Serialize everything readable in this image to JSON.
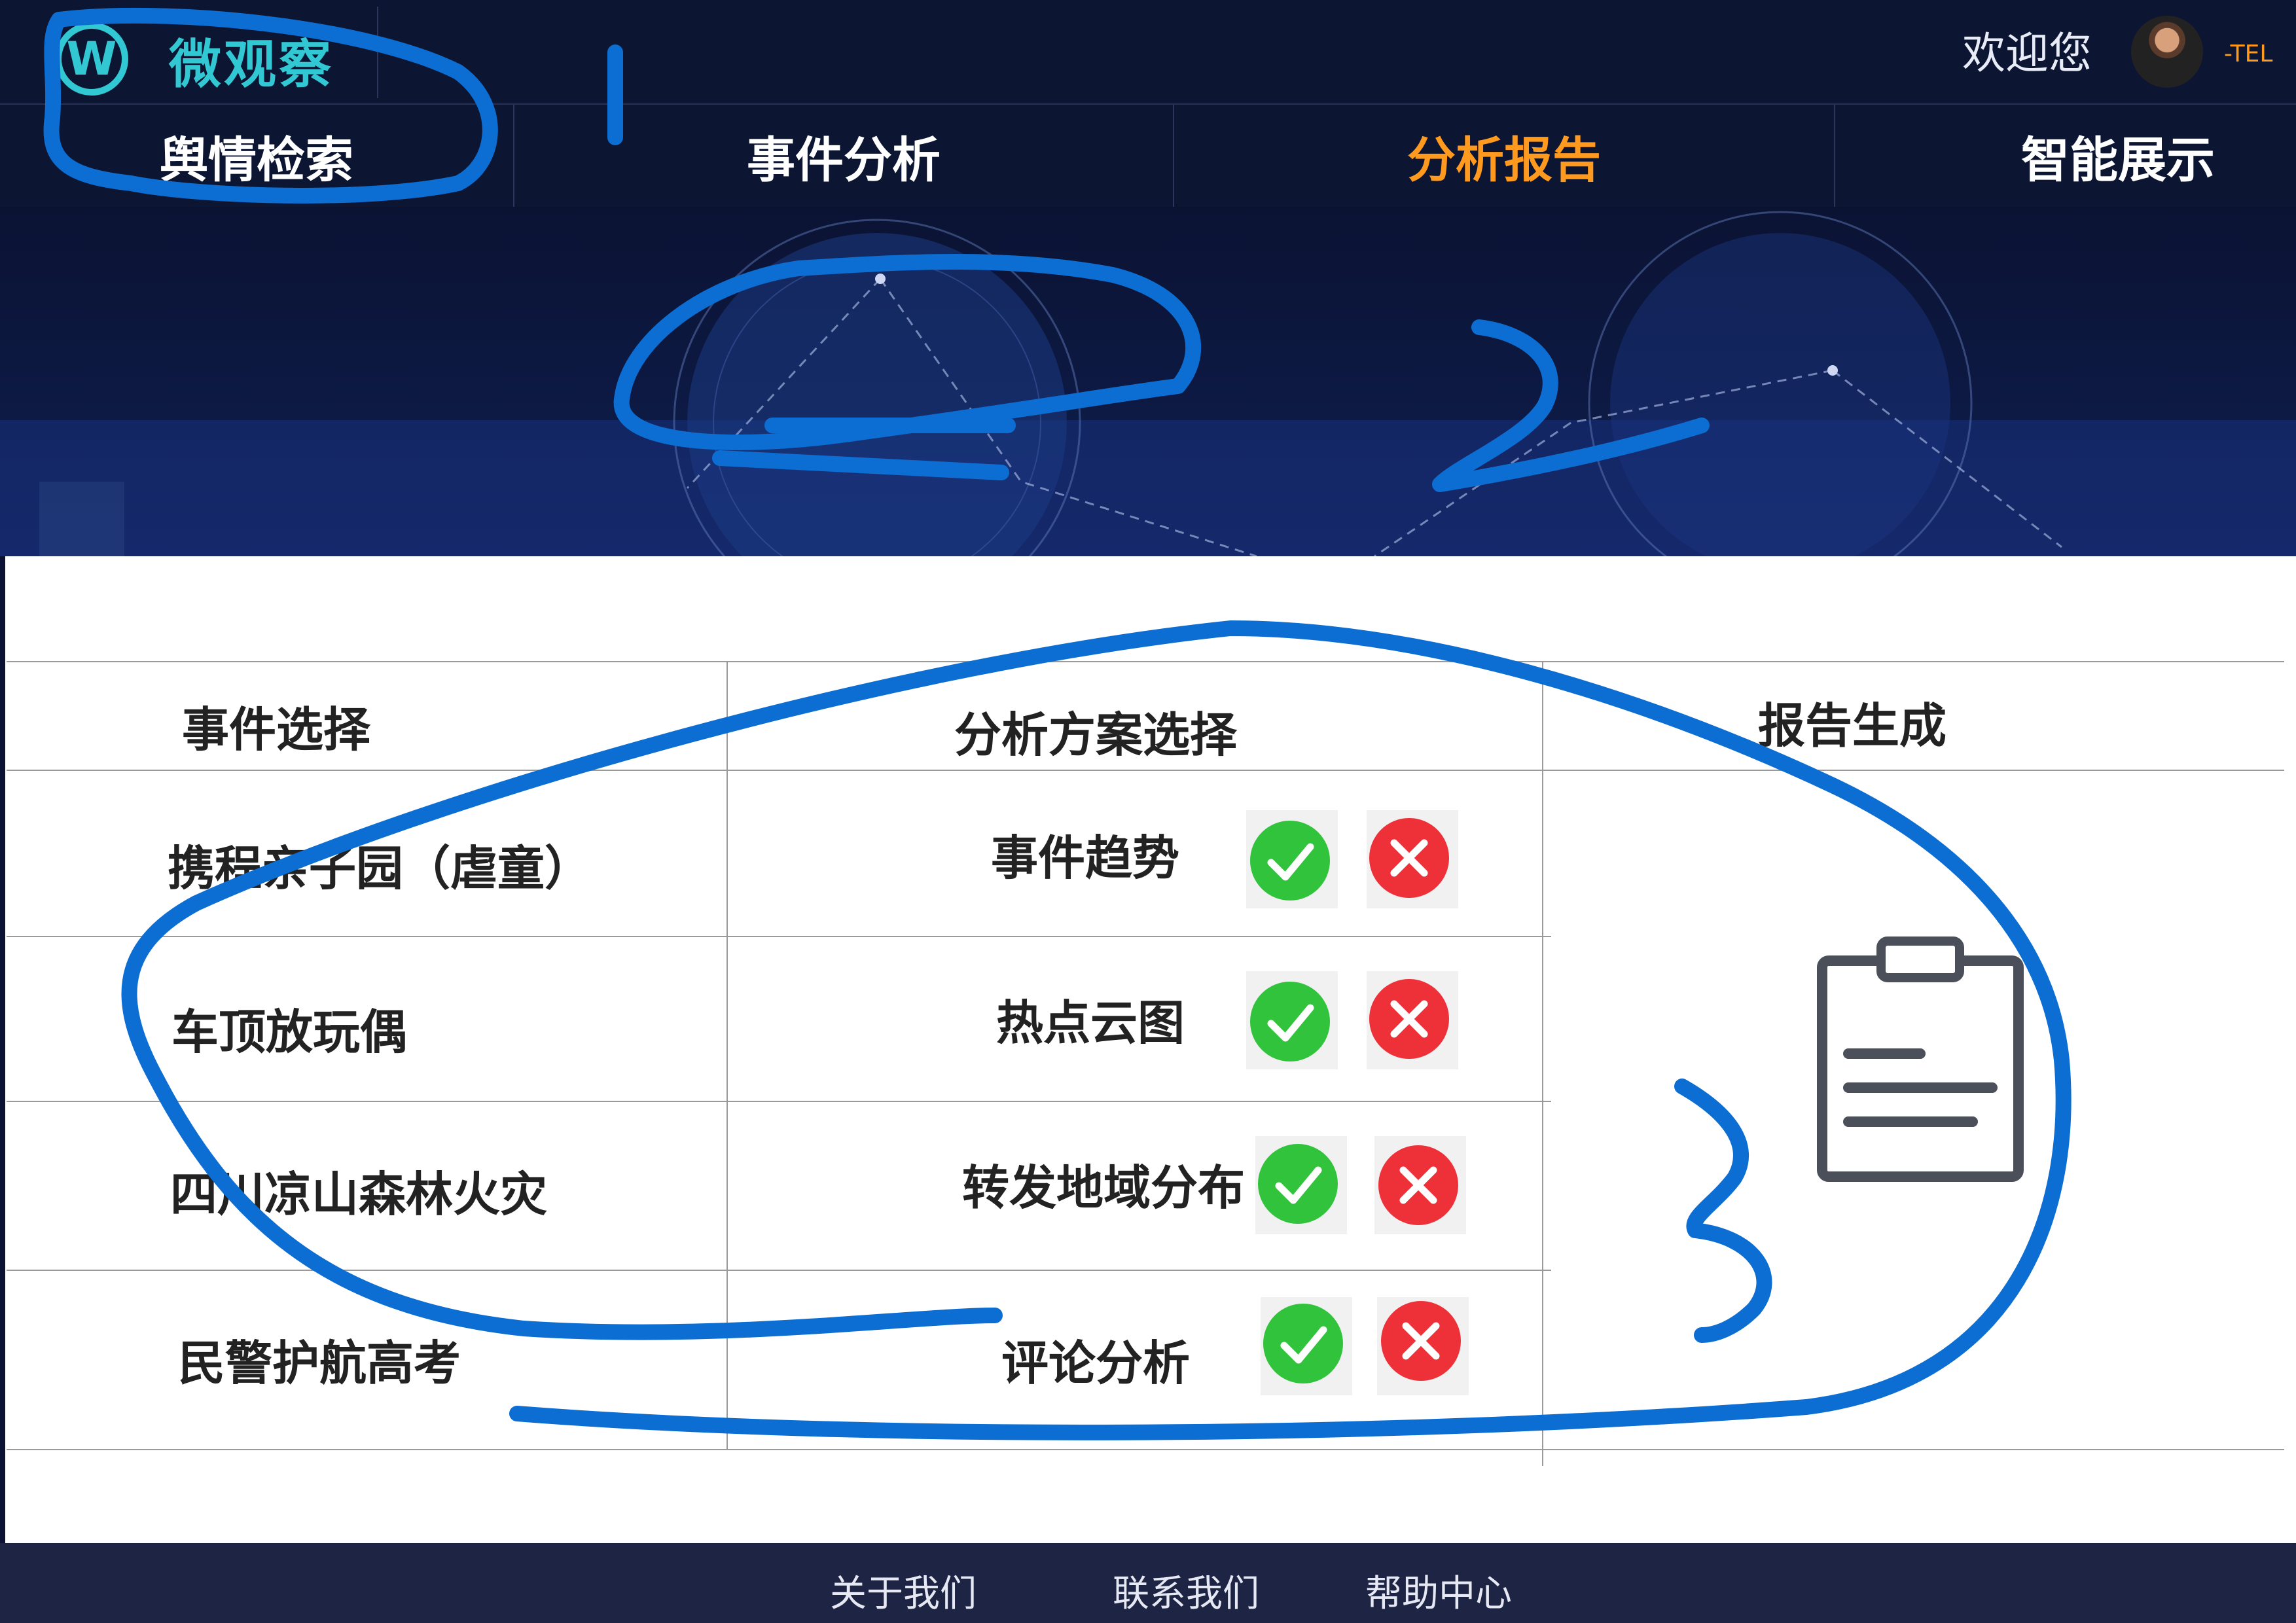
{
  "header": {
    "logo_letter": "W",
    "logo_text": "微观察",
    "welcome": "欢迎您",
    "username": "-TEL"
  },
  "nav": {
    "items": [
      {
        "label": "舆情检索",
        "active": false
      },
      {
        "label": "事件分析",
        "active": false
      },
      {
        "label": "分析报告",
        "active": true
      },
      {
        "label": "智能展示",
        "active": false
      }
    ]
  },
  "table": {
    "headers": {
      "event": "事件选择",
      "scheme": "分析方案选择",
      "report": "报告生成"
    },
    "events": [
      "携程亲子园（虐童）",
      "车顶放玩偶",
      "四川凉山森林火灾",
      "民警护航高考"
    ],
    "schemes": [
      "事件趋势",
      "热点云图",
      "转发地域分布",
      "评论分析"
    ]
  },
  "footer": {
    "links": [
      "关于我们",
      "联系我们",
      "帮助中心"
    ]
  },
  "icons": {
    "confirm": "check-circle-icon",
    "cancel": "x-circle-icon",
    "report": "clipboard-icon"
  },
  "colors": {
    "accent": "#ff9a1f",
    "logo": "#31c8d4",
    "confirm": "#32c33c",
    "cancel": "#ee3039",
    "annotation": "#0c6ed2"
  }
}
